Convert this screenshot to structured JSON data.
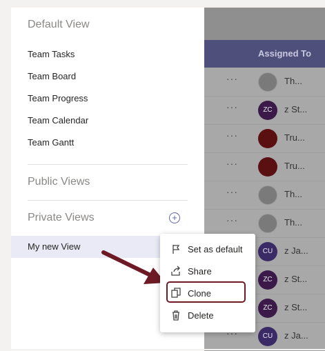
{
  "background": {
    "column_header": "Assigned To",
    "rows": [
      {
        "dots": "···",
        "avatar_type": "photo",
        "initials": "",
        "name": "Th..."
      },
      {
        "dots": "···",
        "avatar_type": "zc",
        "initials": "ZC",
        "name": "z St..."
      },
      {
        "dots": "···",
        "avatar_type": "red",
        "initials": "",
        "name": "Tru..."
      },
      {
        "dots": "···",
        "avatar_type": "red",
        "initials": "",
        "name": "Tru..."
      },
      {
        "dots": "···",
        "avatar_type": "photo",
        "initials": "",
        "name": "Th..."
      },
      {
        "dots": "···",
        "avatar_type": "photo",
        "initials": "",
        "name": "Th..."
      },
      {
        "dots": "···",
        "avatar_type": "cu",
        "initials": "CU",
        "name": "z Ja..."
      },
      {
        "dots": "···",
        "avatar_type": "zc",
        "initials": "ZC",
        "name": "z St..."
      },
      {
        "dots": "···",
        "avatar_type": "zc",
        "initials": "ZC",
        "name": "z St..."
      },
      {
        "dots": "···",
        "avatar_type": "cu",
        "initials": "CU",
        "name": "z Ja..."
      }
    ]
  },
  "panel": {
    "default_view_title": "Default View",
    "default_views": [
      "Team Tasks",
      "Team Board",
      "Team Progress",
      "Team Calendar",
      "Team Gantt"
    ],
    "public_views_title": "Public Views",
    "private_views_title": "Private Views",
    "add_icon": "plus-circle-icon",
    "selected_view": "My new View"
  },
  "menu": {
    "items": [
      {
        "label": "Set as default",
        "icon": "flag-icon"
      },
      {
        "label": "Share",
        "icon": "share-icon"
      },
      {
        "label": "Clone",
        "icon": "copy-icon"
      },
      {
        "label": "Delete",
        "icon": "trash-icon"
      }
    ]
  },
  "colors": {
    "accent": "#6264a7",
    "annotation": "#6e1a24",
    "selected_bg": "#e9eaf6"
  }
}
